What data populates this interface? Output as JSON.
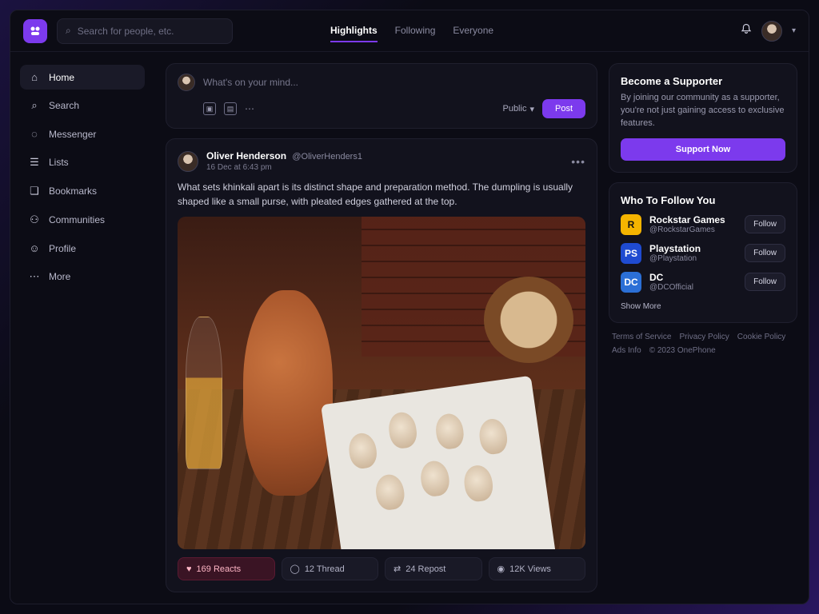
{
  "topbar": {
    "search_placeholder": "Search for people, etc.",
    "feed_tabs": [
      "Highlights",
      "Following",
      "Everyone"
    ],
    "active_tab": "Highlights"
  },
  "sidebar": {
    "items": [
      {
        "label": "Home",
        "icon": "home-icon",
        "glyph": "⌂"
      },
      {
        "label": "Search",
        "icon": "search-icon",
        "glyph": "⌕"
      },
      {
        "label": "Messenger",
        "icon": "chat-icon",
        "glyph": "◌"
      },
      {
        "label": "Lists",
        "icon": "list-icon",
        "glyph": "☰"
      },
      {
        "label": "Bookmarks",
        "icon": "bookmark-icon",
        "glyph": "❏"
      },
      {
        "label": "Communities",
        "icon": "communities-icon",
        "glyph": "⚇"
      },
      {
        "label": "Profile",
        "icon": "profile-icon",
        "glyph": "☺"
      },
      {
        "label": "More",
        "icon": "more-icon",
        "glyph": "⋯"
      }
    ]
  },
  "composer": {
    "placeholder": "What's on your mind...",
    "visibility": "Public",
    "post_label": "Post"
  },
  "post": {
    "author": "Oliver Henderson",
    "handle": "@OliverHenders1",
    "date": "16 Dec at 6:43 pm",
    "text": "What sets khinkali apart is its distinct shape and preparation method. The dumpling is usually shaped like a small purse, with pleated edges gathered at the top.",
    "reacts": "169 Reacts",
    "threads": "12 Thread",
    "reposts": "24 Repost",
    "views": "12K Views"
  },
  "supporter": {
    "title": "Become a Supporter",
    "text": "By joining our community as a supporter, you're not just gaining access to exclusive features.",
    "button": "Support Now"
  },
  "who_to_follow": {
    "title": "Who To Follow You",
    "accounts": [
      {
        "name": "Rockstar Games",
        "handle": "@RockstarGames",
        "mark": "R",
        "bg": "#f5b400",
        "fg": "#111111"
      },
      {
        "name": "Playstation",
        "handle": "@Playstation",
        "mark": "PS",
        "bg": "#1f4bd1",
        "fg": "#ffffff"
      },
      {
        "name": "DC",
        "handle": "@DCOfficial",
        "mark": "DC",
        "bg": "#2b6fd6",
        "fg": "#ffffff"
      }
    ],
    "follow_label": "Follow",
    "show_more": "Show More"
  },
  "footer": [
    "Terms of Service",
    "Privacy Policy",
    "Cookie Policy",
    "Ads Info",
    "© 2023 OnePhone"
  ],
  "colors": {
    "accent": "#7c3aed",
    "background": "#0c0c15",
    "card": "#12121d"
  }
}
